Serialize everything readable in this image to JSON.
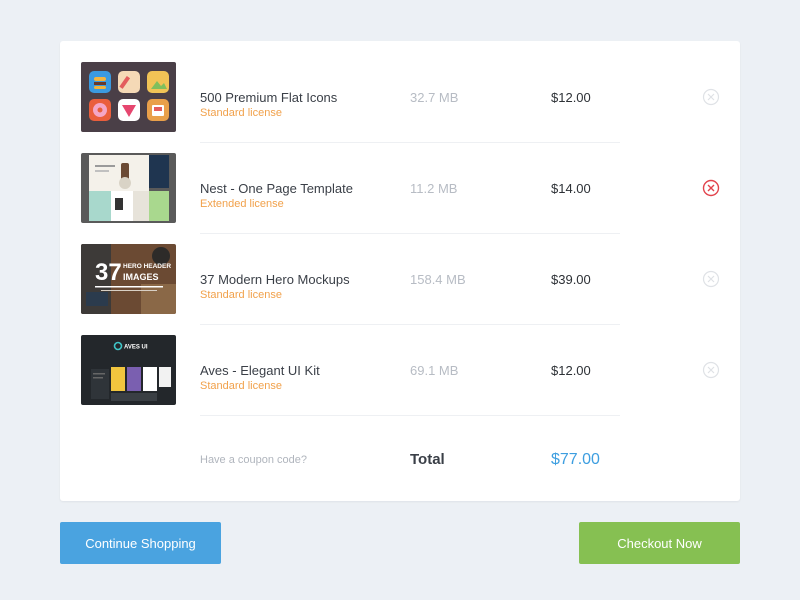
{
  "cart": {
    "items": [
      {
        "name": "500 Premium Flat Icons",
        "license": "Standard license",
        "size": "32.7 MB",
        "price": "$12.00",
        "thumbnail": "flat-icons-thumbnail",
        "remove_state": "inactive"
      },
      {
        "name": "Nest - One Page Template",
        "license": "Extended license",
        "size": "11.2 MB",
        "price": "$14.00",
        "thumbnail": "template-thumbnail",
        "remove_state": "active"
      },
      {
        "name": "37 Modern Hero Mockups",
        "license": "Standard license",
        "size": "158.4 MB",
        "price": "$39.00",
        "thumbnail": "hero-mockups-thumbnail",
        "remove_state": "inactive"
      },
      {
        "name": "Aves - Elegant UI Kit",
        "license": "Standard license",
        "size": "69.1 MB",
        "price": "$12.00",
        "thumbnail": "ui-kit-thumbnail",
        "remove_state": "inactive"
      }
    ],
    "thumb_text": {
      "hero_line1": "37",
      "hero_line2": "HERO HEADER",
      "hero_line3": "IMAGES",
      "aves_logo": "AVES UI"
    },
    "coupon_link": "Have a coupon code?",
    "total_label": "Total",
    "total_value": "$77.00"
  },
  "actions": {
    "continue_label": "Continue Shopping",
    "checkout_label": "Checkout Now"
  },
  "colors": {
    "license": "#f1a14b",
    "remove_active": "#e2434c",
    "remove_inactive": "#dfe2e6",
    "total": "#3d9ee0",
    "continue": "#4aa3e0",
    "checkout": "#86c052",
    "background": "#ecf0f5"
  }
}
